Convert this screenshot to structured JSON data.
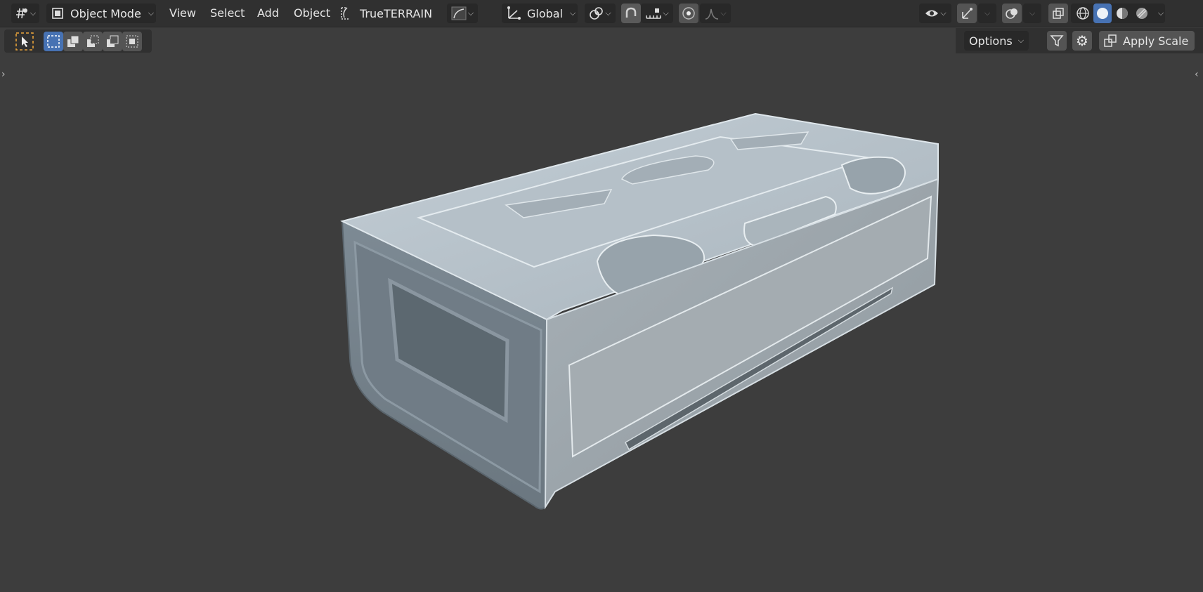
{
  "header": {
    "editor_type_icon": "editor-type-icon",
    "mode": {
      "icon": "object-mode-icon",
      "label": "Object Mode"
    },
    "menus": [
      "View",
      "Select",
      "Add",
      "Object"
    ],
    "addon": {
      "icon": "true-terrain-icon",
      "label": "TrueTERRAIN"
    },
    "transform_orientation": {
      "icon": "orientation-axes-icon",
      "label": "Global"
    },
    "pivot_icon": "pivot-point-icon",
    "snap_icon": "snap-magnet-icon",
    "snap_increment_icon": "snap-increment-icon",
    "proportional_icon": "proportional-editing-icon",
    "falloff_icon": "falloff-curve-icon",
    "visibility_icon": "visibility-eye-icon",
    "gizmo_icon": "gizmo-icon",
    "overlay_icon": "overlay-icon",
    "xray_icon": "xray-icon",
    "shading_modes": [
      "wireframe-icon",
      "solid-sphere-icon",
      "material-sphere-icon",
      "rendered-sphere-icon"
    ],
    "active_shading_index": 1
  },
  "toolbar": {
    "select_tool_icon": "select-cursor-icon",
    "box_modes": [
      "select-new-icon",
      "select-extend-icon",
      "select-subtract-icon",
      "select-invert-icon",
      "select-intersect-icon"
    ],
    "options_label": "Options",
    "filter_icon": "filter-icon",
    "settings_icon": "gear-icon",
    "apply_scale": {
      "icon": "apply-scale-icon",
      "label": "Apply Scale"
    }
  },
  "viewport": {
    "background": "#3d3d3d",
    "object": "sci-fi-crate-model"
  },
  "colors": {
    "accent": "#4772b3",
    "header": "#303030",
    "button": "#545454",
    "snap_active": "#5a5a5a"
  }
}
